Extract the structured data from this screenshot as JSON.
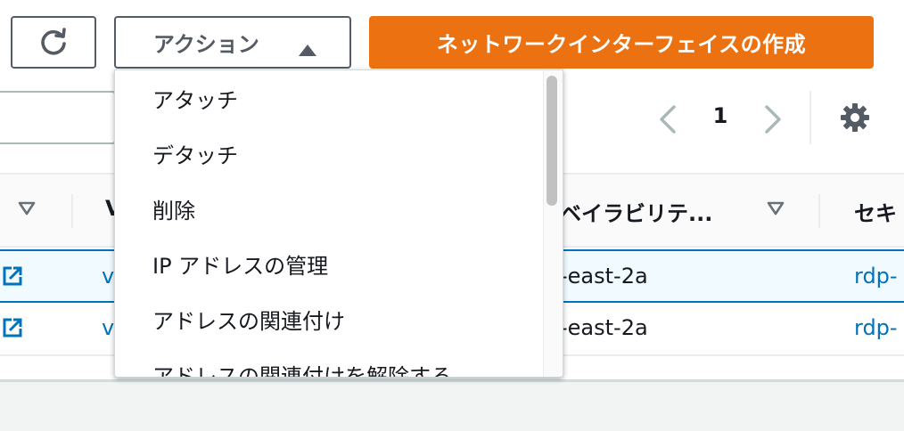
{
  "toolbar": {
    "refresh_icon": "refresh-icon",
    "actions_label": "アクション",
    "actions_caret_icon": "caret-up-icon",
    "create_label": "ネットワークインターフェイスの作成",
    "create_color": "#ec7211"
  },
  "pagination": {
    "current_page": "1",
    "prev_icon": "chevron-left-icon",
    "next_icon": "chevron-right-icon",
    "settings_icon": "gear-icon"
  },
  "table": {
    "columns": [
      {
        "label": ""
      },
      {
        "label": "V"
      },
      {
        "label": "ベイラビリテ..."
      },
      {
        "label": "セキ"
      }
    ],
    "rows": [
      {
        "v": "v",
        "az": "-east-2a",
        "sg": "rdp-",
        "selected": true
      },
      {
        "v": "v",
        "az": "-east-2a",
        "sg": "rdp-",
        "selected": false
      }
    ]
  },
  "actions_menu": {
    "items": [
      {
        "label": "アタッチ"
      },
      {
        "label": "デタッチ"
      },
      {
        "label": "削除"
      },
      {
        "label": "IP アドレスの管理"
      },
      {
        "label": "アドレスの関連付け"
      },
      {
        "label": "アドレスの関連付けを解除する"
      }
    ]
  },
  "colors": {
    "accent_blue": "#0073bb",
    "primary_orange": "#ec7211",
    "border_gray": "#545b64"
  }
}
